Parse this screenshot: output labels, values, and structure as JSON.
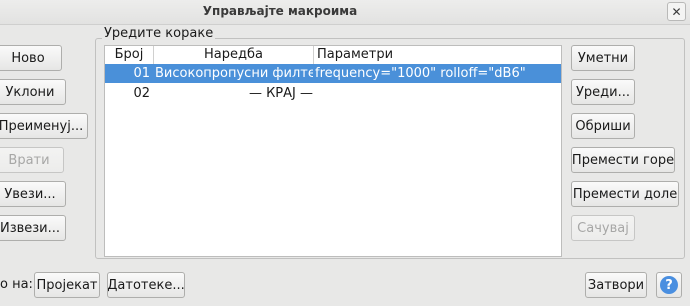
{
  "window": {
    "title": "Управљајте макроима",
    "close_glyph": "✕"
  },
  "left_buttons": {
    "new": "Ново",
    "remove": "Уклони",
    "rename": "Преименуј...",
    "restore": "Врати",
    "import": "Увези...",
    "export": "Извези..."
  },
  "steps_group": {
    "label": "Уредите кораке"
  },
  "columns": {
    "num": "Број",
    "command": "Наредба",
    "params": "Параметри"
  },
  "rows": [
    {
      "num": "01",
      "command": "Високопропусни филтер",
      "params": "frequency=\"1000\" rolloff=\"dB6\""
    },
    {
      "num": "02",
      "command": "— КРАЈ —",
      "params": ""
    }
  ],
  "right_buttons": {
    "insert": "Уметни",
    "edit": "Уреди...",
    "delete": "Обриши",
    "move_up": "Премести горе",
    "move_down": "Премести доле",
    "save": "Сачувај"
  },
  "bottom": {
    "save_to_label": "о на:",
    "project": "Пројекат",
    "files": "Датотеке...",
    "close": "Затвори",
    "help_glyph": "?"
  }
}
